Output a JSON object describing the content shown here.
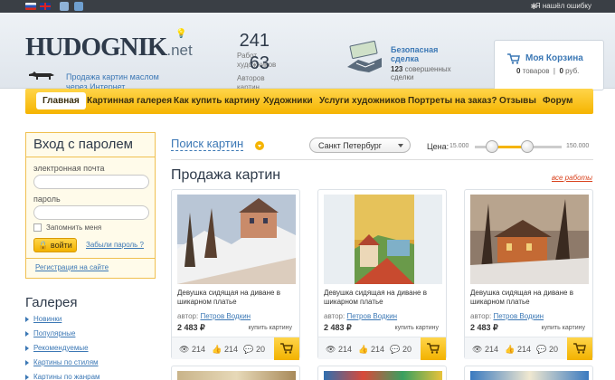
{
  "topbar": {
    "bug_report": "Я нашёл ошибку"
  },
  "header": {
    "logo_main": "HUDOGNIK",
    "logo_suffix": ".net",
    "tagline": "Продажа картин маслом через Интернет",
    "stats": [
      {
        "num": "241",
        "label": "Работ художников"
      },
      {
        "num": "63",
        "label": "Авторов картин"
      }
    ],
    "deal": {
      "title": "Безопасная сделка",
      "count": "123",
      "count_label": "совершенных сделки"
    },
    "cart": {
      "title": "Моя Корзина",
      "items": "0",
      "items_label": "товаров",
      "sum": "0",
      "sum_label": "руб."
    }
  },
  "menu": {
    "items": [
      "Главная",
      "Картинная галерея",
      "Как купить картину",
      "Художники",
      "Услуги художников",
      "Портреты на заказ?",
      "Отзывы",
      "Форум"
    ]
  },
  "login": {
    "title": "Вход с паролем",
    "email_label": "электронная почта",
    "password_label": "пароль",
    "remember": "Запомнить меня",
    "submit": "войти",
    "forgot": "Забыли пароль ?",
    "register": "Регистрация на сайте"
  },
  "gallery": {
    "title": "Галерея",
    "items": [
      "Новинки",
      "Популярные",
      "Рекомендуемые",
      "Картины по стилям",
      "Картины по жанрам"
    ]
  },
  "filter": {
    "search_label": "Поиск картин",
    "city": "Санкт Петербург",
    "price_label": "Цена:",
    "price_min": "15.000",
    "price_max": "150.000",
    "slider_low": 0.2,
    "slider_high": 0.6
  },
  "sale": {
    "title": "Продажа картин",
    "all_link": "все работы",
    "cards": [
      {
        "title": "Девушка сидящая на диване в шикарном платье",
        "author_label": "автор:",
        "author": "Петров Водкин",
        "price": "2 483 ₽",
        "buy": "купить картину",
        "views": "214",
        "likes": "214",
        "comments": "20"
      },
      {
        "title": "Девушка сидящая на диване в шикарном платье",
        "author_label": "автор:",
        "author": "Петров Водкин",
        "price": "2 483 ₽",
        "buy": "купить картину",
        "views": "214",
        "likes": "214",
        "comments": "20"
      },
      {
        "title": "Девушка сидящая на диване в шикарном платье",
        "author_label": "автор:",
        "author": "Петров Водкин",
        "price": "2 483 ₽",
        "buy": "купить картину",
        "views": "214",
        "likes": "214",
        "comments": "20"
      }
    ]
  },
  "colors": {
    "accent": "#f5b400",
    "link": "#3c78b5",
    "dark": "#3a3f45"
  }
}
